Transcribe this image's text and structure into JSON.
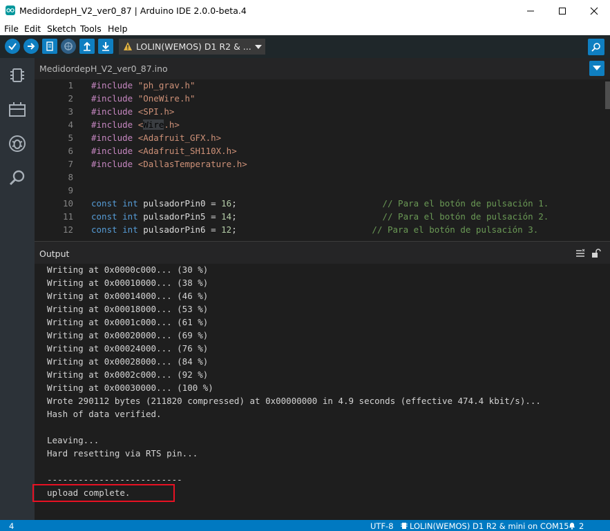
{
  "window": {
    "title": "MedidordepH_V2_ver0_87 | Arduino IDE 2.0.0-beta.4"
  },
  "menu": [
    "File",
    "Edit",
    "Sketch",
    "Tools",
    "Help"
  ],
  "toolbar": {
    "buttons": [
      "verify-icon",
      "upload-icon",
      "debug-icon",
      "new-icon",
      "open-icon",
      "save-icon"
    ],
    "board_label": "LOLIN(WEMOS) D1 R2 & ..."
  },
  "tab": {
    "label": "MedidordepH_V2_ver0_87.ino"
  },
  "editor": {
    "lines": [
      {
        "n": "1",
        "segs": [
          [
            "kw",
            "#include "
          ],
          [
            "str",
            "\"ph_grav.h\""
          ]
        ]
      },
      {
        "n": "2",
        "segs": [
          [
            "kw",
            "#include "
          ],
          [
            "str",
            "\"OneWire.h\""
          ]
        ]
      },
      {
        "n": "3",
        "segs": [
          [
            "kw",
            "#include "
          ],
          [
            "str",
            "<SPI.h>"
          ]
        ]
      },
      {
        "n": "4",
        "segs": [
          [
            "kw",
            "#include "
          ],
          [
            "str",
            "<"
          ],
          [
            "hl",
            "Wire"
          ],
          [
            "str",
            ".h>"
          ]
        ]
      },
      {
        "n": "5",
        "segs": [
          [
            "kw",
            "#include "
          ],
          [
            "str",
            "<Adafruit_GFX.h>"
          ]
        ]
      },
      {
        "n": "6",
        "segs": [
          [
            "kw",
            "#include "
          ],
          [
            "str",
            "<Adafruit_SH110X.h>"
          ]
        ]
      },
      {
        "n": "7",
        "segs": [
          [
            "kw",
            "#include "
          ],
          [
            "str",
            "<DallasTemperature.h>"
          ]
        ]
      },
      {
        "n": "8",
        "segs": []
      },
      {
        "n": "9",
        "segs": []
      },
      {
        "n": "10",
        "segs": [
          [
            "typ",
            "const int "
          ],
          [
            "id",
            "pulsadorPin0 = "
          ],
          [
            "num",
            "16"
          ],
          [
            "id",
            ";                            "
          ],
          [
            "cmt",
            "// Para el botón de pulsación 1."
          ]
        ]
      },
      {
        "n": "11",
        "segs": [
          [
            "typ",
            "const int "
          ],
          [
            "id",
            "pulsadorPin5 = "
          ],
          [
            "num",
            "14"
          ],
          [
            "id",
            ";                            "
          ],
          [
            "cmt",
            "// Para el botón de pulsación 2."
          ]
        ]
      },
      {
        "n": "12",
        "segs": [
          [
            "typ",
            "const int "
          ],
          [
            "id",
            "pulsadorPin6 = "
          ],
          [
            "num",
            "12"
          ],
          [
            "id",
            ";                          "
          ],
          [
            "cmt",
            "// Para el botón de pulsación 3."
          ]
        ]
      }
    ]
  },
  "output": {
    "title": "Output",
    "lines": [
      "Writing at 0x0000c000... (30 %)",
      "Writing at 0x00010000... (38 %)",
      "Writing at 0x00014000... (46 %)",
      "Writing at 0x00018000... (53 %)",
      "Writing at 0x0001c000... (61 %)",
      "Writing at 0x00020000... (69 %)",
      "Writing at 0x00024000... (76 %)",
      "Writing at 0x00028000... (84 %)",
      "Writing at 0x0002c000... (92 %)",
      "Writing at 0x00030000... (100 %)",
      "Wrote 290112 bytes (211820 compressed) at 0x00000000 in 4.9 seconds (effective 474.4 kbit/s)...",
      "Hash of data verified.",
      "",
      "Leaving...",
      "Hard resetting via RTS pin...",
      "",
      "--------------------------",
      "upload complete."
    ]
  },
  "status": {
    "left": "4",
    "encoding": "UTF-8",
    "board_port": "LOLIN(WEMOS) D1 R2 & mini on COM15",
    "notifications": "2"
  },
  "colors": {
    "accent": "#0f7fc1",
    "status_bar": "#0079c1",
    "highlight_box": "#e81123"
  }
}
